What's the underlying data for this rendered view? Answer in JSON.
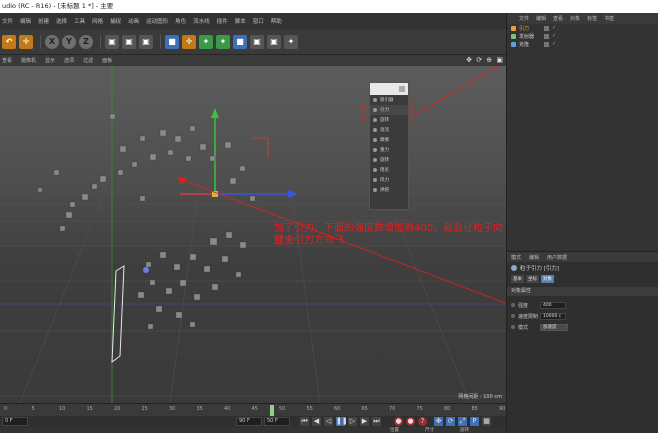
{
  "window": {
    "title": "udio (RC - R16) - [未标题 1 *] - 主要"
  },
  "menubar": [
    "文件",
    "编辑",
    "创建",
    "选择",
    "工具",
    "网格",
    "捕捉",
    "动画",
    "运动图形",
    "角色",
    "流水线",
    "插件",
    "脚本",
    "窗口",
    "帮助"
  ],
  "toolbar": {
    "buttons": [
      {
        "icon": "undo-icon",
        "glyph": "↶"
      },
      {
        "icon": "move-icon",
        "glyph": "✛"
      },
      {
        "icon": "axis-x-icon",
        "glyph": "X"
      },
      {
        "icon": "axis-y-icon",
        "glyph": "Y"
      },
      {
        "icon": "axis-z-icon",
        "glyph": "Z"
      },
      {
        "icon": "render-icon",
        "glyph": "▣"
      },
      {
        "icon": "cube-icon",
        "glyph": "■"
      },
      {
        "icon": "light-icon",
        "glyph": "✦"
      }
    ]
  },
  "viewport_menu": [
    "查看",
    "摄像机",
    "显示",
    "选项",
    "过滤",
    "面板"
  ],
  "viewport_icons": "✥ ⟳ ⊕ ▣",
  "popup": {
    "items": [
      "吸引器",
      "引力",
      "旋转",
      "湍流",
      "摩擦",
      "重力",
      "旋转",
      "阻尼",
      "风力",
      "烘焙"
    ],
    "highlighted": 1
  },
  "annotation": {
    "line1": "加了引力，下面的强度数增加到400，就会让粒子向那个引力方向飞",
    "line2": "过去",
    "color": "#e02020"
  },
  "grid_label": "网格间距 : 100 cm",
  "objects_panel": {
    "menu": [
      "文件",
      "编辑",
      "查看",
      "对象",
      "标签",
      "书签"
    ],
    "objects": [
      {
        "name": "引力",
        "color": "#e0a04a",
        "active": true
      },
      {
        "name": "发射器",
        "color": "#7cc27c",
        "active": false
      },
      {
        "name": "克隆",
        "color": "#66a0d8",
        "active": false
      }
    ]
  },
  "attributes_panel": {
    "tabs": [
      "模式",
      "编辑",
      "用户数据"
    ],
    "title": "粒子引力 [引力]",
    "buttons": [
      "基本",
      "坐标",
      "对象"
    ],
    "selected_button": 2,
    "section": "对象属性",
    "fields": [
      {
        "label": "强度",
        "value": "400"
      },
      {
        "label": "速度限制",
        "value": "10000 c"
      }
    ],
    "mode": {
      "label": "模式",
      "value": "加速度"
    }
  },
  "timeline": {
    "ticks": [
      "0",
      "5",
      "10",
      "15",
      "20",
      "25",
      "30",
      "35",
      "40",
      "45",
      "50",
      "55",
      "60",
      "65",
      "70",
      "75",
      "80",
      "85",
      "90"
    ],
    "current_frame": 50,
    "start_field": "0 F",
    "end_field": "90 F",
    "current_field": "50 F"
  },
  "bottom_bar": [
    "位置",
    "尺寸",
    "旋转"
  ]
}
